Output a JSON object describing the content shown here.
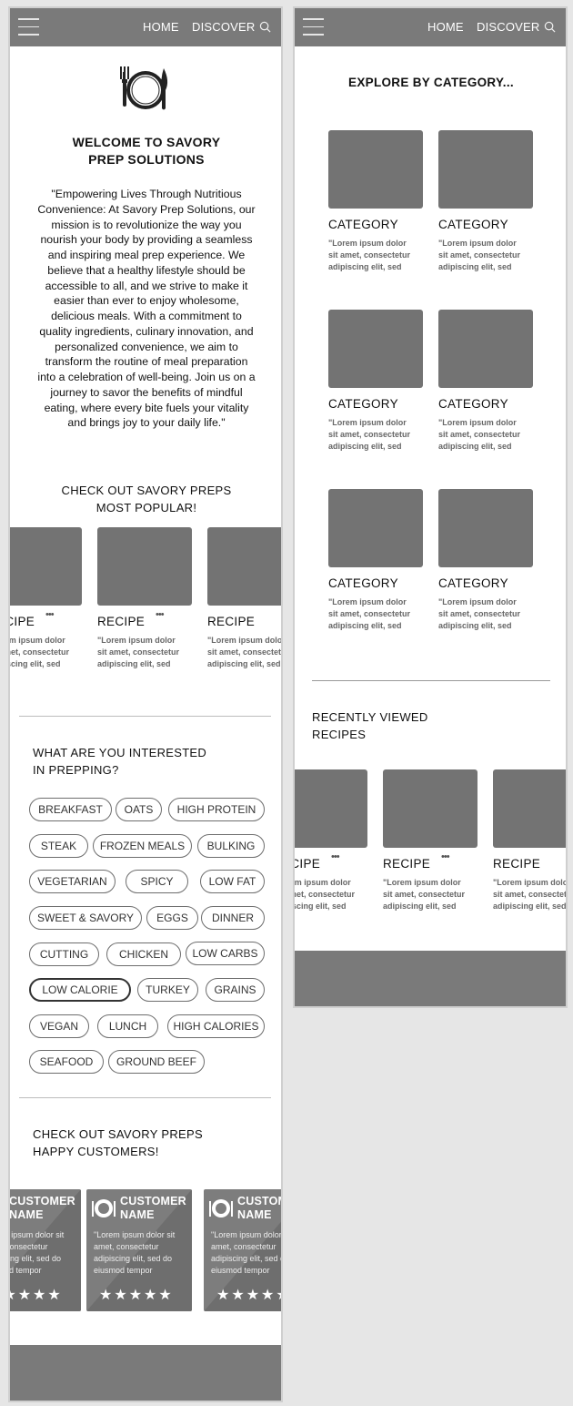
{
  "nav": {
    "home_label": "HOME",
    "discover_label": "DISCOVER"
  },
  "home": {
    "welcome_line1": "WELCOME TO SAVORY",
    "welcome_line2": "PREP SOLUTIONS",
    "mission_text": "\"Empowering Lives Through Nutritious Convenience: At Savory Prep Solutions, our mission is to revolutionize the way you nourish your body by providing a seamless and inspiring meal prep experience. We believe that a healthy lifestyle should be accessible to all, and we strive to make it easier than ever to enjoy wholesome, delicious meals. With a commitment to quality ingredients, culinary innovation, and personalized convenience, we aim to transform the routine of meal preparation into a celebration of well-being. Join us on a journey to savor the benefits of mindful eating, where every bite fuels your vitality and brings joy to your daily life.\"",
    "popular_line1": "CHECK OUT SAVORY PREPS",
    "popular_line2": "MOST POPULAR!",
    "popular_cards": [
      {
        "title": "RECIPE",
        "desc": "\"Lorem ipsum dolor sit amet, consectetur adipiscing elit, sed"
      },
      {
        "title": "RECIPE",
        "desc": "\"Lorem ipsum dolor sit amet, consectetur adipiscing elit, sed"
      },
      {
        "title": "RECIPE",
        "desc": "\"Lorem ipsum dolor sit amet, consectetur adipiscing elit, sed"
      }
    ],
    "interest_line1": "WHAT ARE YOU INTERESTED",
    "interest_line2": "IN PREPPING?",
    "tags": [
      "BREAKFAST",
      "OATS",
      "HIGH PROTEIN",
      "STEAK",
      "FROZEN MEALS",
      "BULKING",
      "VEGETARIAN",
      "SPICY",
      "LOW FAT",
      "SWEET & SAVORY",
      "EGGS",
      "DINNER",
      "CUTTING",
      "CHICKEN",
      "LOW CARBS",
      "LOW CALORIE",
      "TURKEY",
      "GRAINS",
      "VEGAN",
      "LUNCH",
      "HIGH CALORIES",
      "SEAFOOD",
      "GROUND BEEF"
    ],
    "selected_tag": "LOW CALORIE",
    "customers_line1": "CHECK OUT SAVORY PREPS",
    "customers_line2": "HAPPY CUSTOMERS!",
    "testimonials": [
      {
        "name": "CUSTOMER NAME",
        "quote": "\"Lorem ipsum dolor sit amet, consectetur adipiscing elit, sed do eiusmod tempor",
        "stars": "★★★★★"
      },
      {
        "name": "CUSTOMER NAME",
        "quote": "\"Lorem ipsum dolor sit amet, consectetur adipiscing elit, sed do eiusmod tempor",
        "stars": "★★★★★"
      },
      {
        "name": "CUSTOMER NAME",
        "quote": "\"Lorem ipsum dolor sit amet, consectetur adipiscing elit, sed do eiusmod tempor",
        "stars": "★★★★★"
      }
    ]
  },
  "discover": {
    "explore_title": "EXPLORE BY CATEGORY...",
    "categories": [
      {
        "title": "CATEGORY",
        "desc": "\"Lorem ipsum dolor sit amet, consectetur adipiscing elit, sed"
      },
      {
        "title": "CATEGORY",
        "desc": "\"Lorem ipsum dolor sit amet, consectetur adipiscing elit, sed"
      },
      {
        "title": "CATEGORY",
        "desc": "\"Lorem ipsum dolor sit amet, consectetur adipiscing elit, sed"
      },
      {
        "title": "CATEGORY",
        "desc": "\"Lorem ipsum dolor sit amet, consectetur adipiscing elit, sed"
      },
      {
        "title": "CATEGORY",
        "desc": "\"Lorem ipsum dolor sit amet, consectetur adipiscing elit, sed"
      },
      {
        "title": "CATEGORY",
        "desc": "\"Lorem ipsum dolor sit amet, consectetur adipiscing elit, sed"
      }
    ],
    "recent_line1": "RECENTLY VIEWED",
    "recent_line2": "RECIPES",
    "recent_cards": [
      {
        "title": "RECIPE",
        "desc": "\"Lorem ipsum dolor sit amet, consectetur adipiscing elit, sed"
      },
      {
        "title": "RECIPE",
        "desc": "\"Lorem ipsum dolor sit amet, consectetur adipiscing elit, sed"
      },
      {
        "title": "RECIPE",
        "desc": "\"Lorem ipsum dolor sit amet, consectetur adipiscing elit, sed"
      }
    ]
  },
  "colors": {
    "header_gray": "#7a7a7a",
    "thumb_gray": "#737373",
    "background": "#e6e6e6"
  },
  "icons": [
    "hamburger-menu-icon",
    "search-icon",
    "logo-plate-icon",
    "more-dots-icon",
    "plate-icon",
    "star-icon"
  ]
}
